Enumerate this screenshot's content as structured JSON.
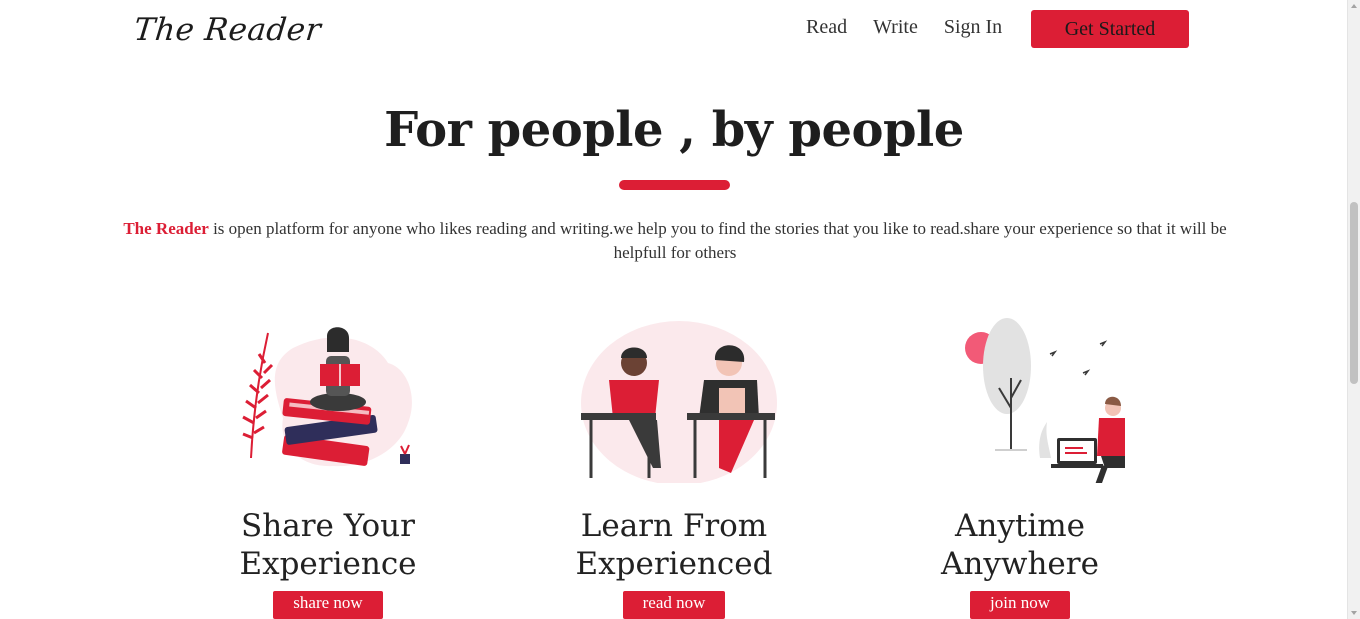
{
  "brand": {
    "logo_text": "The Reader",
    "accent_color": "#dc1e35"
  },
  "nav": {
    "items": [
      {
        "label": "Read"
      },
      {
        "label": "Write"
      },
      {
        "label": "Sign In"
      }
    ],
    "cta_label": "Get Started"
  },
  "hero": {
    "title": "For people , by people",
    "brand_inline": "The Reader",
    "description": " is open platform for anyone who likes reading and writing.we help you to find the stories that you like to read.share your experience so that it will be helpfull for others"
  },
  "features": [
    {
      "title_line1": "Share Your",
      "title_line2": "Experience",
      "button_label": "share now",
      "illustration": "reading-on-books-illustration"
    },
    {
      "title_line1": "Learn From",
      "title_line2": "Experienced",
      "button_label": "read now",
      "illustration": "students-at-desks-illustration"
    },
    {
      "title_line1": "Anytime",
      "title_line2": "Anywhere",
      "button_label": "join now",
      "illustration": "laptop-outdoors-illustration"
    }
  ]
}
